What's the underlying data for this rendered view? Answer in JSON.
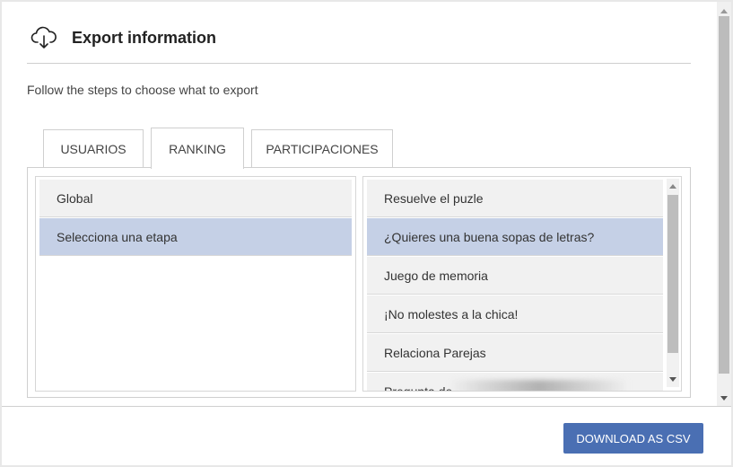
{
  "header": {
    "title": "Export information",
    "icon": "cloud-download-icon"
  },
  "subtitle": "Follow the steps to choose what to export",
  "tabs": [
    {
      "label": "USUARIOS",
      "active": false
    },
    {
      "label": "RANKING",
      "active": true
    },
    {
      "label": "PARTICIPACIONES",
      "active": false
    }
  ],
  "left_list": {
    "items": [
      {
        "label": "Global",
        "selected": false
      },
      {
        "label": "Selecciona una etapa",
        "selected": true
      }
    ]
  },
  "right_list": {
    "items": [
      {
        "label": "Resuelve el puzle",
        "selected": false
      },
      {
        "label": "¿Quieres una buena sopas de letras?",
        "selected": true
      },
      {
        "label": "Juego de memoria",
        "selected": false
      },
      {
        "label": "¡No molestes a la chica!",
        "selected": false
      },
      {
        "label": "Relaciona Parejas",
        "selected": false
      },
      {
        "label": "Pregunta de ...",
        "selected": false
      }
    ]
  },
  "footer": {
    "download_label": "DOWNLOAD AS CSV"
  },
  "colors": {
    "accent": "#4a6fb3",
    "selected_row": "#c5d0e6",
    "row_bg": "#f1f1f1"
  }
}
